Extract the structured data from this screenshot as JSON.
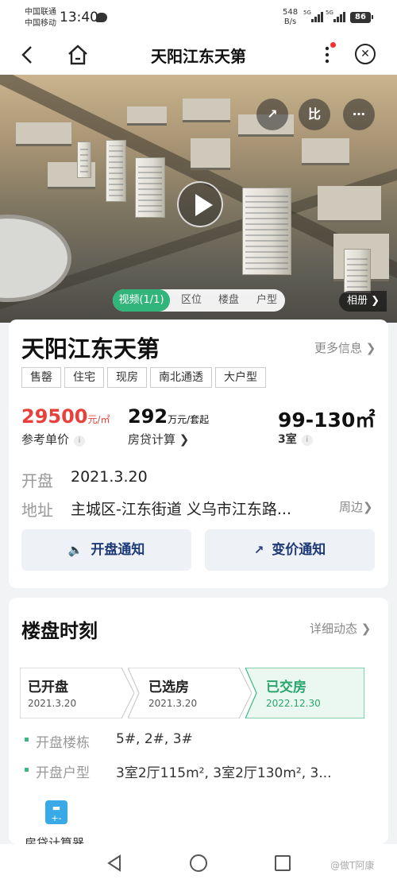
{
  "status_bar": {
    "carrier1": "中国联通",
    "carrier2": "中国移动",
    "time": "13:40",
    "net_speed_value": "548",
    "net_speed_unit": "B/s",
    "signal1_label": "5G",
    "signal2_label": "5G",
    "battery": "86"
  },
  "nav": {
    "title": "天阳江东天第"
  },
  "hero": {
    "tabs": [
      "视频(1/1)",
      "区位",
      "楼盘",
      "户型"
    ],
    "active_tab": 0,
    "album_label": "相册",
    "tool_icons": [
      "share-icon",
      "compare-icon",
      "chat-icon"
    ]
  },
  "property": {
    "name": "天阳江东天第",
    "more_info": "更多信息",
    "tags": [
      "售罄",
      "住宅",
      "现房",
      "南北通透",
      "大户型"
    ],
    "price": "29500",
    "price_unit": "元/㎡",
    "price_label": "参考单价",
    "loan": "292",
    "loan_unit": "万元/套起",
    "loan_label": "房贷计算",
    "area": "99-130㎡",
    "rooms": "3室",
    "rooms_suffix": "室",
    "open_label": "开盘",
    "open_date": "2021.3.20",
    "address_label": "地址",
    "address": "主城区-江东街道 义乌市江东路...",
    "nearby": "周边",
    "btn_open_notice": "开盘通知",
    "btn_price_notice": "变价通知"
  },
  "timeline": {
    "title": "楼盘时刻",
    "detail": "详细动态",
    "steps": [
      {
        "name": "已开盘",
        "date": "2021.3.20",
        "done": false
      },
      {
        "name": "已选房",
        "date": "2021.3.20",
        "done": false
      },
      {
        "name": "已交房",
        "date": "2022.12.30",
        "done": true
      }
    ],
    "buildings_label": "开盘楼栋",
    "buildings": "5#, 2#, 3#",
    "types_label": "开盘户型",
    "types": "3室2厅115m², 3室2厅130m², 3...",
    "calc_label": "房贷计算器"
  },
  "bottom": {
    "watermark": "@做T阿康"
  },
  "colors": {
    "accent_green": "#32b57a",
    "price_red": "#e8413b",
    "button_text": "#1f3a78"
  }
}
